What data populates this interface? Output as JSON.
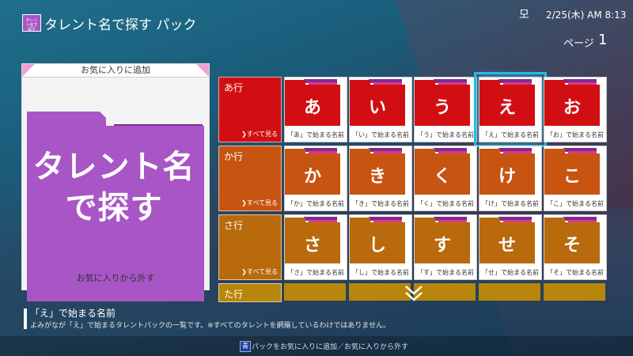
{
  "header": {
    "app_icon_text": "タレント名で探す",
    "title": "タレント名で探す パック",
    "user_icon": "모",
    "clock": "2/25(木) AM 8:13",
    "page_label": "ページ",
    "page_number": "1"
  },
  "favorite_card": {
    "top_label": "お気に入りに追加",
    "big_text_line1": "タレント名",
    "big_text_line2": "で探す",
    "bottom_label": "お気に入りから外す"
  },
  "rows": [
    {
      "title": "あ行",
      "see_all": "❯すべて見る",
      "color": "#d10f13",
      "tiles": [
        {
          "kana": "あ",
          "caption": "「あ」で始まる名前"
        },
        {
          "kana": "い",
          "caption": "「い」で始まる名前"
        },
        {
          "kana": "う",
          "caption": "「う」で始まる名前"
        },
        {
          "kana": "え",
          "caption": "「え」で始まる名前"
        },
        {
          "kana": "お",
          "caption": "「お」で始まる名前"
        }
      ]
    },
    {
      "title": "か行",
      "see_all": "❯すべて見る",
      "color": "#c85412",
      "tiles": [
        {
          "kana": "か",
          "caption": "「か」で始まる名前"
        },
        {
          "kana": "き",
          "caption": "「き」で始まる名前"
        },
        {
          "kana": "く",
          "caption": "「く」で始まる名前"
        },
        {
          "kana": "け",
          "caption": "「け」で始まる名前"
        },
        {
          "kana": "こ",
          "caption": "「こ」で始まる名前"
        }
      ]
    },
    {
      "title": "さ行",
      "see_all": "❯すべて見る",
      "color": "#b86a0c",
      "tiles": [
        {
          "kana": "さ",
          "caption": "「さ」で始まる名前"
        },
        {
          "kana": "し",
          "caption": "「し」で始まる名前"
        },
        {
          "kana": "す",
          "caption": "「す」で始まる名前"
        },
        {
          "kana": "せ",
          "caption": "「せ」で始まる名前"
        },
        {
          "kana": "そ",
          "caption": "「そ」で始まる名前"
        }
      ]
    },
    {
      "title": "た行",
      "color": "#b8860c"
    }
  ],
  "selected_tile": "え",
  "scroll_hint": "chevron-down-icon",
  "info": {
    "title": "「え」で始まる名前",
    "description": "よみがなが「え」で始まるタレントパックの一覧です。※すべてのタレントを網羅しているわけではありません。"
  },
  "footer": {
    "button_label": "青",
    "text": "パックをお気に入りに追加／お気に入りから外す"
  },
  "colors": {
    "accent_selection": "#2bb9e6",
    "folder_purple": "#a855c6",
    "tab_pink": "#e2358f",
    "tab_purple": "#7b2e8f"
  }
}
